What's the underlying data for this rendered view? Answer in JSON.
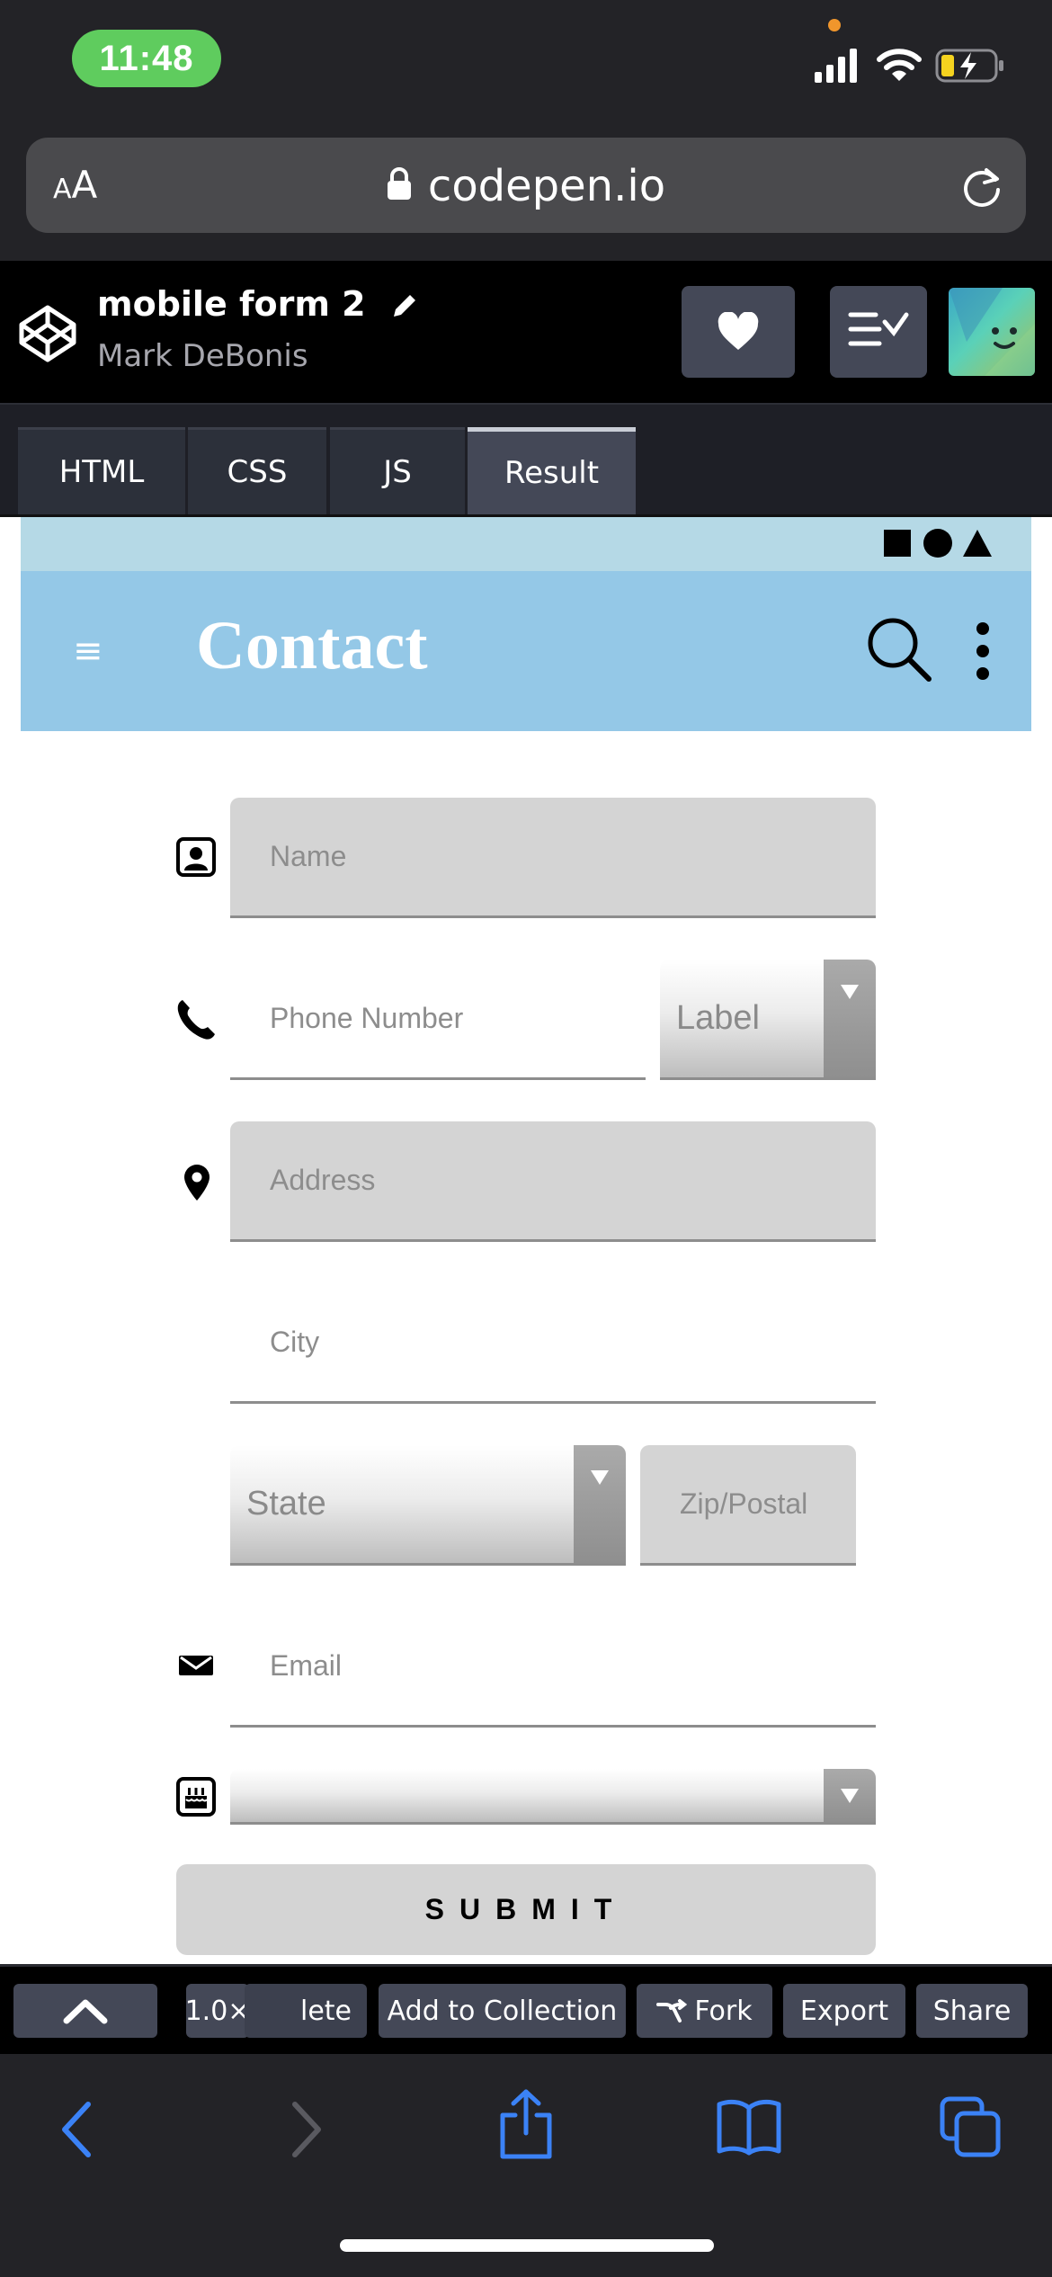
{
  "status_bar": {
    "time": "11:48"
  },
  "browser": {
    "text_size_small": "A",
    "text_size_big": "A",
    "url": "codepen.io"
  },
  "pen": {
    "title": "mobile form 2",
    "author": "Mark DeBonis"
  },
  "tabs": [
    {
      "label": "HTML",
      "active": false
    },
    {
      "label": "CSS",
      "active": false
    },
    {
      "label": "JS",
      "active": false
    },
    {
      "label": "Result",
      "active": true
    }
  ],
  "app": {
    "menu_glyph": "≡",
    "title": "Contact",
    "bar_color": "#94c8e7",
    "status_color": "#b5d9e6"
  },
  "form": {
    "name_placeholder": "Name",
    "phone_placeholder": "Phone Number",
    "phone_label_select": "Label",
    "address_placeholder": "Address",
    "city_placeholder": "City",
    "state_select": "State",
    "zip_placeholder": "Zip/Postal",
    "email_placeholder": "Email",
    "birthday_select": "",
    "submit_label": "SUBMIT"
  },
  "bottom_bar": {
    "zoom": "1.0×",
    "delete_partial": "lete",
    "add_to_collection": "Add to Collection",
    "fork": "Fork",
    "export": "Export",
    "share": "Share"
  },
  "icons": {
    "lock": "lock-icon",
    "reload": "reload-icon",
    "codepen": "codepen-logo-icon",
    "heart": "heart-icon",
    "layout": "layout-icon",
    "fork": "fork-icon"
  }
}
